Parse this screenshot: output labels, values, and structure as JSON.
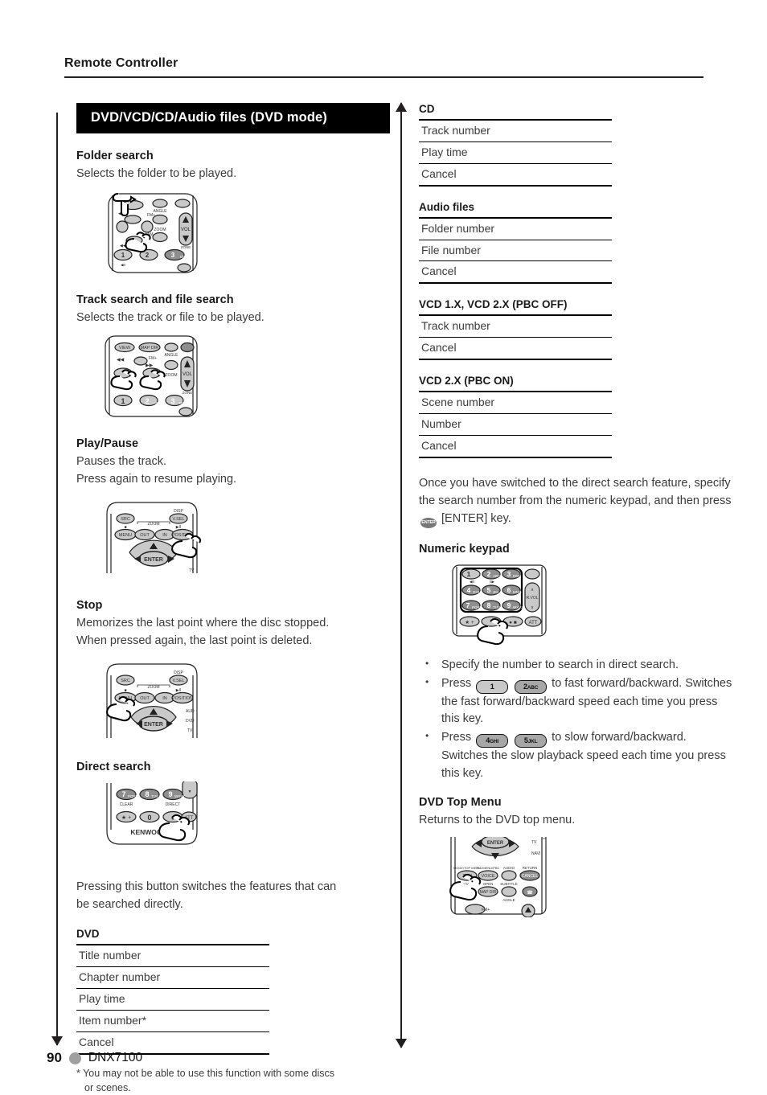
{
  "header": {
    "title": "Remote Controller"
  },
  "banner": {
    "title": "DVD/VCD/CD/Audio files (DVD mode)"
  },
  "left_column": {
    "sections": [
      {
        "heading": "Folder search",
        "lines": [
          "Selects the folder to be played."
        ]
      },
      {
        "heading": "Track search and file search",
        "lines": [
          "Selects the track or file to be played."
        ]
      },
      {
        "heading": "Play/Pause",
        "lines": [
          "Pauses the track.",
          "Press again to resume playing."
        ]
      },
      {
        "heading": "Stop",
        "lines": [
          "Memorizes the last point where the disc stopped.",
          "When pressed again, the last point is deleted."
        ]
      },
      {
        "heading": "Direct search",
        "lines": []
      }
    ],
    "direct_search_note": [
      "Pressing this button switches the features that can",
      "be searched directly."
    ],
    "dvd_table": {
      "title": "DVD",
      "rows": [
        "Title number",
        "Chapter number",
        "Play time",
        "Item number*",
        "Cancel"
      ]
    },
    "footnote": {
      "line1": "* You may not be able to use this function with some discs",
      "line2": "or scenes."
    }
  },
  "right_column": {
    "cd_table": {
      "title": "CD",
      "rows": [
        "Track number",
        "Play time",
        "Cancel"
      ]
    },
    "audio_files_table": {
      "title": "Audio files",
      "rows": [
        "Folder number",
        "File number",
        "Cancel"
      ]
    },
    "vcd1_table": {
      "title": "VCD 1.X, VCD 2.X (PBC OFF)",
      "rows": [
        "Track number",
        "Cancel"
      ]
    },
    "vcd2_table": {
      "title": "VCD 2.X (PBC ON)",
      "rows": [
        "Scene number",
        "Number",
        "Cancel"
      ]
    },
    "direct_search_paragraph": {
      "part1": "Once you have switched to the direct search feature, specify the search number from the numeric keypad, and then press",
      "enter_key_label": "ENTER",
      "part2": "[ENTER] key."
    },
    "numeric_keypad": {
      "heading": "Numeric keypad"
    },
    "bullets": [
      {
        "text": "Specify the number to search in direct search."
      },
      {
        "prefix": "Press",
        "keys": [
          {
            "digit": "1",
            "letters": ""
          },
          {
            "digit": "2",
            "letters": "ABC"
          }
        ],
        "text": "to fast forward/backward.",
        "continuation": "Switches the fast forward/backward speed each time you press this key."
      },
      {
        "prefix": "Press",
        "keys": [
          {
            "digit": "4",
            "letters": "GHI"
          },
          {
            "digit": "5",
            "letters": "JKL"
          }
        ],
        "text": "to slow forward/backward.",
        "continuation": "Switches the slow playback speed each time you press this key."
      }
    ],
    "dvd_top_menu": {
      "heading": "DVD Top Menu",
      "line": "Returns to the DVD top menu."
    }
  },
  "remote_labels": {
    "folder_search": [
      "FM+",
      "AM-",
      "ANGLE",
      "ZOOM",
      "VOL",
      "ZONE",
      "1",
      "3",
      "DEF"
    ],
    "track_search": [
      "VIEW",
      "MAP DIR",
      "FM+",
      "ANGLE",
      "ZOOM",
      "VOL",
      "ZONE",
      "1",
      "2",
      "ABC",
      "3",
      "DEF"
    ],
    "play_pause": [
      "SRC",
      "DISP",
      "V.SEL",
      "ZOOM",
      "MENU",
      "OUT",
      "IN",
      "POSITION",
      "ENTER",
      "TV"
    ],
    "stop": [
      "SRC",
      "DISP",
      "V.SEL",
      "ZOOM",
      "MENU",
      "OUT",
      "IN",
      "POSITION",
      "ENTER",
      "AUD",
      "DVD",
      "TV"
    ],
    "direct_search": [
      "7",
      "PQRS",
      "8",
      "TUV",
      "9",
      "WXYZ",
      "CLEAR",
      "DIRECT",
      "0",
      "ATT",
      "KENWOOD"
    ],
    "numeric_keypad": [
      "1",
      "2",
      "ABC",
      "3",
      "DEF",
      "4",
      "GHI",
      "5",
      "JKL",
      "6",
      "MNO",
      "7",
      "PQRS",
      "8",
      "TUV",
      "9",
      "WXYZ",
      "R.VOL",
      "ATT"
    ],
    "dvd_top_menu": [
      "ENTER",
      "TV",
      "NAVI",
      "MODE/TOP MENU",
      "PIC/MENU/PBC",
      "AUDIO",
      "RETURN",
      "TV/V",
      "VOICE",
      "CANCEL",
      "A/V",
      "OPEN",
      "MAP DIR",
      "SUBTITLE",
      "ANGLE",
      "FM+"
    ]
  },
  "footer": {
    "page_number": "90",
    "model": "DNX7100"
  },
  "colors": {
    "banner_bg": "#000000",
    "banner_text": "#ffffff",
    "body_text": "#3b3b3b",
    "heading_text": "#1a1a1a",
    "footer_dot": "#a0a0a0",
    "key_fill": "#a7a7a7"
  }
}
